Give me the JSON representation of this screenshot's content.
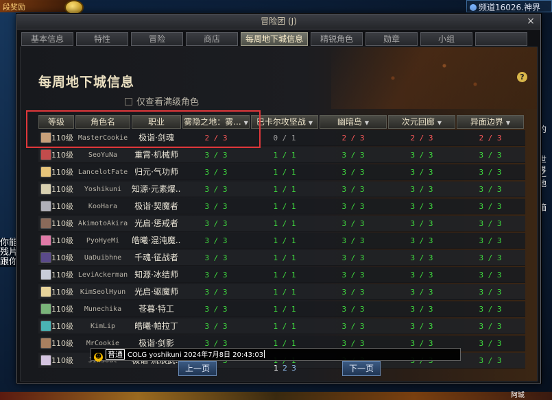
{
  "background": {
    "top_banner": "段奖励",
    "channel": "频道16026.神界",
    "side_text": [
      "你能",
      "残片",
      "跟你"
    ],
    "right_text": [
      "的",
      "世界",
      "之地",
      "箱"
    ],
    "bottom_right": "阿城"
  },
  "window": {
    "title": "冒险团 (J)",
    "close": "×"
  },
  "tabs": [
    {
      "label": "基本信息",
      "active": false
    },
    {
      "label": "特性",
      "active": false
    },
    {
      "label": "冒险",
      "active": false
    },
    {
      "label": "商店",
      "active": false
    },
    {
      "label": "每周地下城信息",
      "active": true
    },
    {
      "label": "精锐角色",
      "active": false
    },
    {
      "label": "勋章",
      "active": false
    },
    {
      "label": "小组",
      "active": false
    },
    {
      "label": "",
      "active": false
    }
  ],
  "page": {
    "title": "每周地下城信息",
    "help": "?",
    "filter_label": "仅查看满级角色"
  },
  "table": {
    "headers": [
      "等级",
      "角色名",
      "职业",
      "雾隐之地：雾...",
      "巴卡尔攻坚战",
      "幽暗岛",
      "次元回廊",
      "异面边界"
    ],
    "rows": [
      {
        "level": "110级",
        "name": "MasterCookie",
        "job": "极诣·剑魂",
        "d1": "2 / 3",
        "d2": "0 / 1",
        "d3": "2 / 3",
        "d4": "2 / 3",
        "d5": "2 / 3",
        "c1": "red",
        "c2": "gray",
        "c3": "red",
        "c4": "red",
        "c5": "red",
        "avatar": "#c7a07a"
      },
      {
        "level": "110级",
        "name": "SeoYuNa",
        "job": "重霄·机械师",
        "d1": "3 / 3",
        "d2": "1 / 1",
        "d3": "3 / 3",
        "d4": "3 / 3",
        "d5": "3 / 3",
        "c1": "green",
        "c2": "green",
        "c3": "green",
        "c4": "green",
        "c5": "green",
        "avatar": "#c24c4c"
      },
      {
        "level": "110级",
        "name": "LancelotFate",
        "job": "归元·气功师",
        "d1": "3 / 3",
        "d2": "1 / 1",
        "d3": "3 / 3",
        "d4": "3 / 3",
        "d5": "3 / 3",
        "c1": "green",
        "c2": "green",
        "c3": "green",
        "c4": "green",
        "c5": "green",
        "avatar": "#e6c47a"
      },
      {
        "level": "110级",
        "name": "Yoshikuni",
        "job": "知源·元素爆...",
        "d1": "3 / 3",
        "d2": "1 / 1",
        "d3": "3 / 3",
        "d4": "3 / 3",
        "d5": "3 / 3",
        "c1": "green",
        "c2": "green",
        "c3": "green",
        "c4": "green",
        "c5": "green",
        "avatar": "#d8d0b0"
      },
      {
        "level": "110级",
        "name": "KooHara",
        "job": "极诣·契魔者",
        "d1": "3 / 3",
        "d2": "1 / 1",
        "d3": "3 / 3",
        "d4": "3 / 3",
        "d5": "3 / 3",
        "c1": "green",
        "c2": "green",
        "c3": "green",
        "c4": "green",
        "c5": "green",
        "avatar": "#b0b0b8"
      },
      {
        "level": "110级",
        "name": "AkimotoAkira",
        "job": "光启·惩戒者",
        "d1": "3 / 3",
        "d2": "1 / 1",
        "d3": "3 / 3",
        "d4": "3 / 3",
        "d5": "3 / 3",
        "c1": "green",
        "c2": "green",
        "c3": "green",
        "c4": "green",
        "c5": "green",
        "avatar": "#8a6a5a"
      },
      {
        "level": "110级",
        "name": "PyoHyeMi",
        "job": "皓曦·混沌魔...",
        "d1": "3 / 3",
        "d2": "1 / 1",
        "d3": "3 / 3",
        "d4": "3 / 3",
        "d5": "3 / 3",
        "c1": "green",
        "c2": "green",
        "c3": "green",
        "c4": "green",
        "c5": "green",
        "avatar": "#e07aa8"
      },
      {
        "level": "110级",
        "name": "UaDuibhne",
        "job": "千魂·征战者",
        "d1": "3 / 3",
        "d2": "1 / 1",
        "d3": "3 / 3",
        "d4": "3 / 3",
        "d5": "3 / 3",
        "c1": "green",
        "c2": "green",
        "c3": "green",
        "c4": "green",
        "c5": "green",
        "avatar": "#5a4a8a"
      },
      {
        "level": "110级",
        "name": "LeviAckerman",
        "job": "知源·冰结师",
        "d1": "3 / 3",
        "d2": "1 / 1",
        "d3": "3 / 3",
        "d4": "3 / 3",
        "d5": "3 / 3",
        "c1": "green",
        "c2": "green",
        "c3": "green",
        "c4": "green",
        "c5": "green",
        "avatar": "#c8ccd8"
      },
      {
        "level": "110级",
        "name": "KimSeolHyun",
        "job": "光启·驱魔师",
        "d1": "3 / 3",
        "d2": "1 / 1",
        "d3": "3 / 3",
        "d4": "3 / 3",
        "d5": "3 / 3",
        "c1": "green",
        "c2": "green",
        "c3": "green",
        "c4": "green",
        "c5": "green",
        "avatar": "#e8d49a"
      },
      {
        "level": "110级",
        "name": "Munechika",
        "job": "苍暮·特工",
        "d1": "3 / 3",
        "d2": "1 / 1",
        "d3": "3 / 3",
        "d4": "3 / 3",
        "d5": "3 / 3",
        "c1": "green",
        "c2": "green",
        "c3": "green",
        "c4": "green",
        "c5": "green",
        "avatar": "#7ab47a"
      },
      {
        "level": "110级",
        "name": "KimLip",
        "job": "皓曦·帕拉丁",
        "d1": "3 / 3",
        "d2": "1 / 1",
        "d3": "3 / 3",
        "d4": "3 / 3",
        "d5": "3 / 3",
        "c1": "green",
        "c2": "green",
        "c3": "green",
        "c4": "green",
        "c5": "green",
        "avatar": "#4ab4b4"
      },
      {
        "level": "110级",
        "name": "MrCookie",
        "job": "极诣·剑影",
        "d1": "3 / 3",
        "d2": "1 / 1",
        "d3": "3 / 3",
        "d4": "3 / 3",
        "d5": "3 / 3",
        "c1": "green",
        "c2": "green",
        "c3": "green",
        "c4": "green",
        "c5": "green",
        "avatar": "#a88060"
      },
      {
        "level": "110级",
        "name": "JinSoul",
        "job": "极诣·流浪武...",
        "d1": "3 / 3",
        "d2": "1 / 1",
        "d3": "3 / 3",
        "d4": "3 / 3",
        "d5": "3 / 3",
        "c1": "green",
        "c2": "green",
        "c3": "green",
        "c4": "green",
        "c5": "green",
        "avatar": "#d4c4e0"
      }
    ]
  },
  "chat": {
    "icon": "smile-icon",
    "channel": "普通",
    "text": "COLG yoshikuni 2024年7月8日 20:43:03"
  },
  "pager": {
    "prev": "上一页",
    "next": "下一页",
    "pages": [
      "1",
      "2",
      "3"
    ],
    "current": "1"
  },
  "colors": {
    "green": "#3fdc3f",
    "red": "#ff5a5a",
    "highlight": "#e0373a"
  }
}
